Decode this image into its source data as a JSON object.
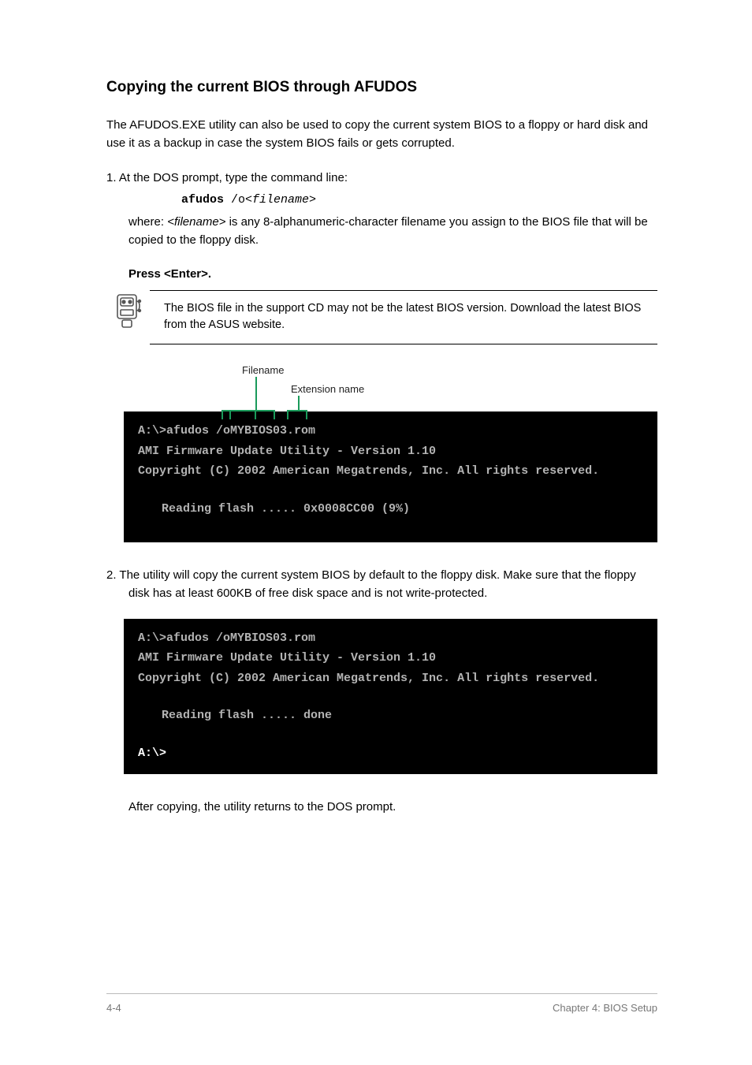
{
  "section": {
    "heading": "Copying the current BIOS through AFUDOS",
    "intro": "The AFUDOS.EXE utility can also be used to copy the current system BIOS to a floppy or hard disk and use it as a backup in case the system BIOS fails or gets corrupted.",
    "step1_prefix": "1. ",
    "step1_text": "At the DOS prompt, type the command line:",
    "command_parts": {
      "cmd": "afudos",
      "switch": " /o",
      "filename_var": "<filename>"
    },
    "where_prefix": "where:",
    "where_text": " is any 8-alphanumeric-character filename you assign to the BIOS file that will be copied to the floppy disk.",
    "press_enter": "Press <Enter>.",
    "note": "The BIOS file in the support CD may not be the latest BIOS version. Download the latest BIOS from the ASUS website.",
    "annotation": {
      "filename": "Filename",
      "extension": "Extension name"
    },
    "terminal1": {
      "line1": "A:\\>afudos /oMYBIOS03.rom",
      "line2": "AMI Firmware Update Utility - Version 1.10",
      "line3": "Copyright (C) 2002 American Megatrends, Inc. All rights reserved.",
      "line4": "Reading flash ..... 0x0008CC00 (9%)"
    },
    "step2_prefix": "2. ",
    "step2_text": "The utility will copy the current system BIOS by default to the floppy disk. Make sure that the floppy disk has at least 600KB of free disk space and is not write-protected.",
    "terminal2": {
      "line1": "A:\\>afudos /oMYBIOS03.rom",
      "line2": "AMI Firmware Update Utility - Version 1.10",
      "line3": "Copyright (C) 2002 American Megatrends, Inc. All rights reserved.",
      "line4": "Reading flash ..... done",
      "line5": "A:\\>"
    },
    "closing": "After copying, the utility returns to the DOS prompt."
  },
  "footer": {
    "left": "4-4",
    "right": "Chapter 4: BIOS Setup"
  }
}
